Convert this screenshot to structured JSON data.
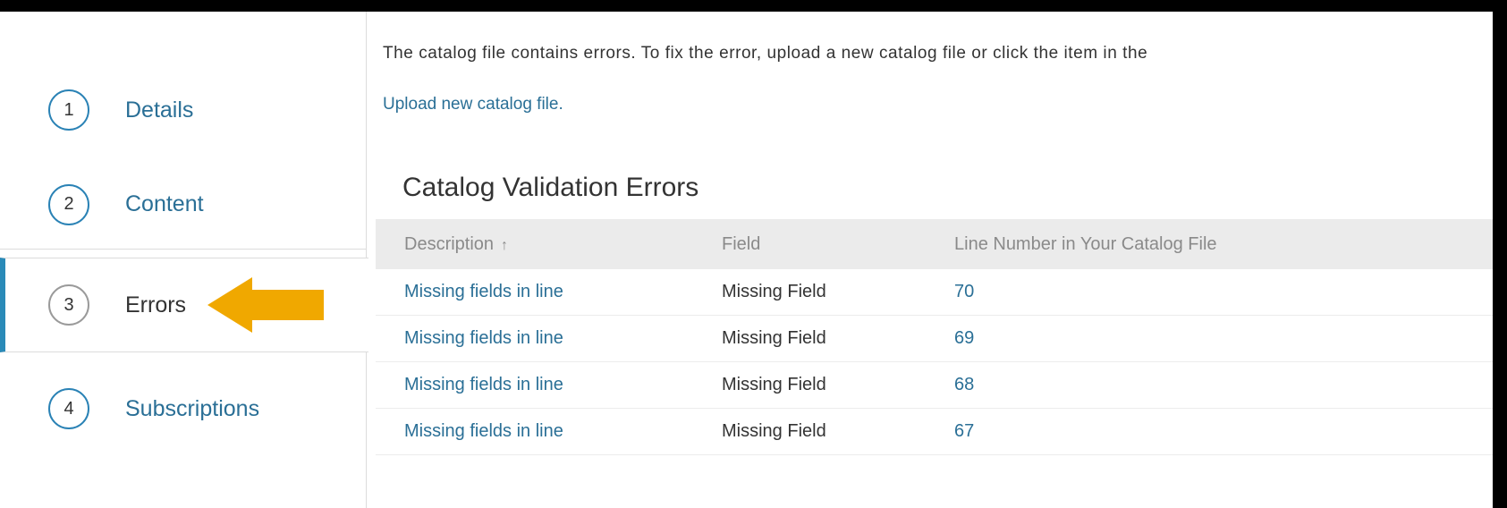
{
  "wizard": {
    "steps": [
      {
        "number": "1",
        "label": "Details"
      },
      {
        "number": "2",
        "label": "Content"
      },
      {
        "number": "3",
        "label": "Errors"
      },
      {
        "number": "4",
        "label": "Subscriptions"
      }
    ],
    "active_step": "3"
  },
  "main": {
    "intro_text": "The catalog file contains errors. To fix the error, upload a new catalog file or click the item in the",
    "upload_link": "Upload new catalog file.",
    "section_title": "Catalog Validation Errors"
  },
  "table": {
    "headers": [
      "Description",
      "Field",
      "Line Number in Your Catalog File"
    ],
    "sort_icon": "↑",
    "rows": [
      {
        "description": "Missing fields in line",
        "field": "Missing Field",
        "line": "70"
      },
      {
        "description": "Missing fields in line",
        "field": "Missing Field",
        "line": "69"
      },
      {
        "description": "Missing fields in line",
        "field": "Missing Field",
        "line": "68"
      },
      {
        "description": "Missing fields in line",
        "field": "Missing Field",
        "line": "67"
      }
    ]
  },
  "colors": {
    "accent": "#2a82b5",
    "link": "#2a6f96",
    "arrow": "#f0a800"
  }
}
